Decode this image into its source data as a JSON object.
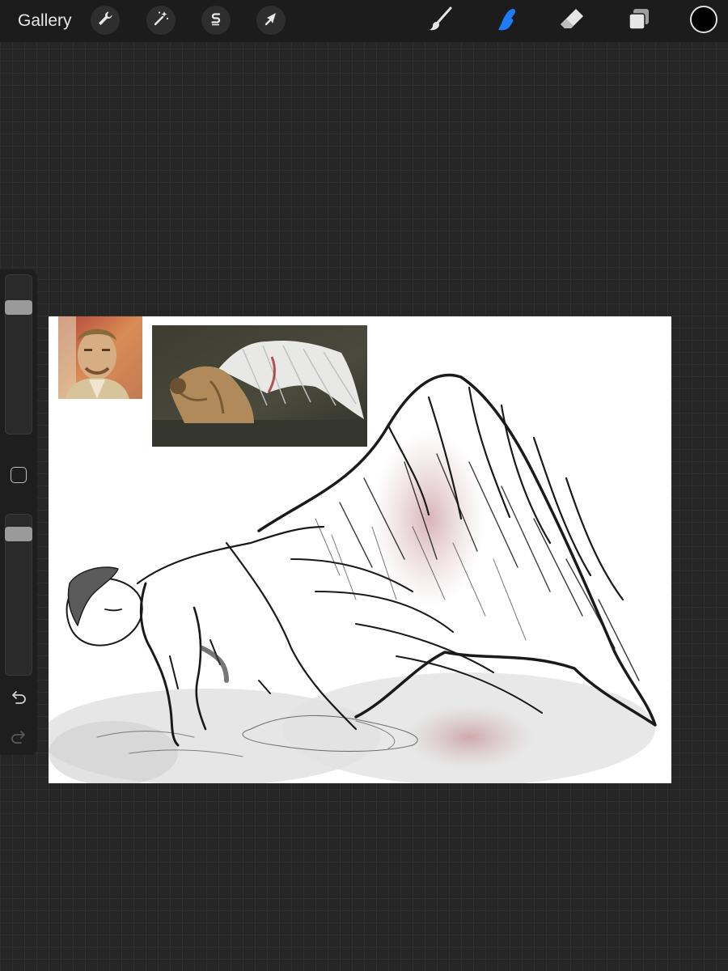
{
  "app": {
    "gallery_label": "Gallery"
  },
  "toolbar": {
    "left_tools": [
      {
        "name": "actions",
        "icon": "wrench-icon"
      },
      {
        "name": "adjustments",
        "icon": "magic-wand-icon"
      },
      {
        "name": "selection",
        "icon": "selection-s-icon"
      },
      {
        "name": "transform",
        "icon": "arrow-cursor-icon"
      }
    ],
    "right_tools": [
      {
        "name": "brush",
        "icon": "brush-icon",
        "active": false
      },
      {
        "name": "smudge",
        "icon": "smudge-finger-icon",
        "active": true
      },
      {
        "name": "eraser",
        "icon": "eraser-icon",
        "active": false
      },
      {
        "name": "layers",
        "icon": "layers-icon",
        "active": false
      }
    ],
    "active_color": "#000000",
    "active_tool_accent": "#1e7cf5"
  },
  "sidebar": {
    "brush_size_level": 0.84,
    "opacity_level": 0.93,
    "undo_icon": "undo-arrow-icon",
    "redo_icon": "redo-arrow-icon",
    "modify_icon": "square-modify-icon"
  },
  "canvas": {
    "background": "#ffffff",
    "references": [
      {
        "name": "portrait-reference",
        "icon": "portrait-photo"
      },
      {
        "name": "winged-figure-reference",
        "icon": "winged-figure-photo"
      }
    ],
    "artwork": "pencil-sketch-winged-figure"
  }
}
